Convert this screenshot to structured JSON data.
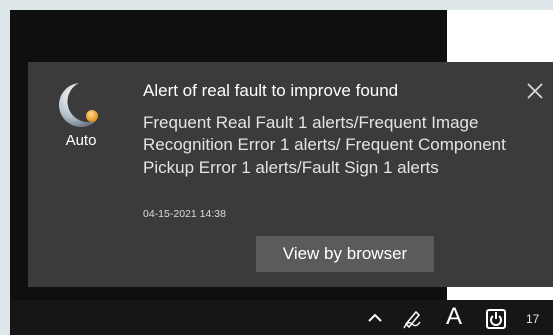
{
  "notification": {
    "app_name": "Auto",
    "title": "Alert of real fault to improve found",
    "message": "Frequent Real Fault 1 alerts/Frequent Image Recognition Error 1 alerts/ Frequent Component Pickup Error 1 alerts/Fault Sign 1 alerts",
    "timestamp": "04-15-2021 14:38",
    "action_label": "View by browser",
    "close_icon": "close-icon",
    "logo_icon": "auto-app-logo"
  },
  "taskbar": {
    "tray_icons": [
      "chevron-up-icon",
      "pen-workspace-icon",
      "input-method-icon",
      "app-tray-icon"
    ],
    "input_method_label": "A",
    "clock_text": "17"
  },
  "colors": {
    "toast_background": "#3b3b3b",
    "button_background": "#5b5b5b",
    "taskbar_background": "#161616",
    "logo_accent": "#e8a020"
  }
}
